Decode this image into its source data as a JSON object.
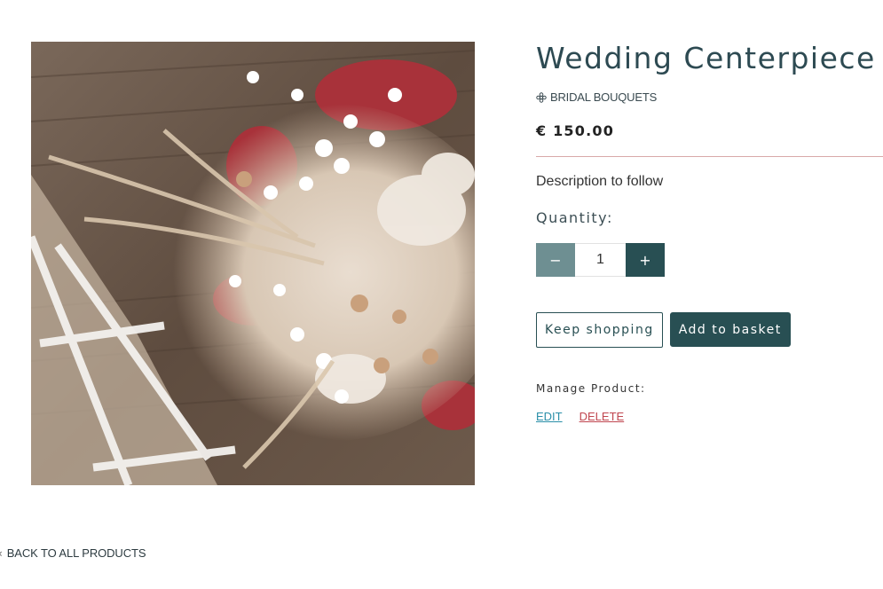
{
  "product": {
    "image_alt": "Wedding Centerpiece",
    "title": "Wedding Centerpiece",
    "category_icon": "flower-icon",
    "category": "BRIDAL BOUQUETS",
    "price": "€ 150.00",
    "description": "Description to follow"
  },
  "quantity": {
    "label": "Quantity:",
    "value": "1",
    "decrement_label": "−",
    "increment_label": "+"
  },
  "actions": {
    "keep_shopping": "Keep shopping",
    "add_to_basket": "Add to basket"
  },
  "manage": {
    "label": "Manage Product:",
    "edit": "EDIT",
    "delete": "DELETE"
  },
  "back": {
    "icon": "chevron-left-icon",
    "label": "BACK TO ALL PRODUCTS"
  },
  "colors": {
    "brand_dark": "#284f53",
    "brand_light": "#6e8f92",
    "edit_link": "#2a8fa8",
    "delete_link": "#c0464f",
    "divider": "#d9a9a9"
  }
}
